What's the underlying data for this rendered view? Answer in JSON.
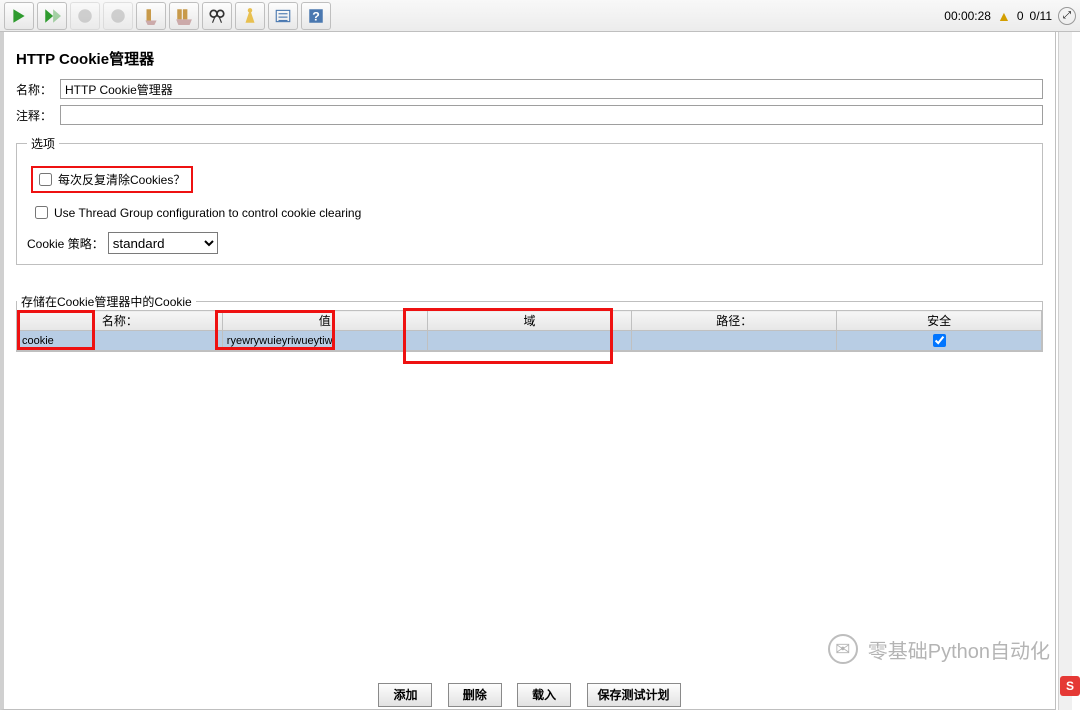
{
  "toolbar": {
    "timer": "00:00:28",
    "warn_count": "0",
    "counter": "0/11"
  },
  "header": {
    "title": "HTTP Cookie管理器",
    "name_label": "名称：",
    "name_value": "HTTP Cookie管理器",
    "comment_label": "注释：",
    "comment_value": ""
  },
  "options": {
    "legend": "选项",
    "clear_each_label": "每次反复清除Cookies？",
    "clear_each_checked": false,
    "use_thread_group_label": "Use Thread Group configuration to control cookie clearing",
    "use_thread_group_checked": false,
    "policy_label": "Cookie 策略：",
    "policy_value": "standard"
  },
  "cookies": {
    "legend": "存储在Cookie管理器中的Cookie",
    "columns": {
      "name": "名称：",
      "value": "值",
      "domain": "域",
      "path": "路径：",
      "secure": "安全"
    },
    "rows": [
      {
        "name": "cookie",
        "value": "ryewrywuieyriwueytiw",
        "domain": "",
        "path": "",
        "secure": true
      }
    ]
  },
  "buttons": {
    "add": "添加",
    "delete": "删除",
    "load": "载入",
    "save": "保存测试计划"
  },
  "watermark": "零基础Python自动化",
  "ime": "S"
}
